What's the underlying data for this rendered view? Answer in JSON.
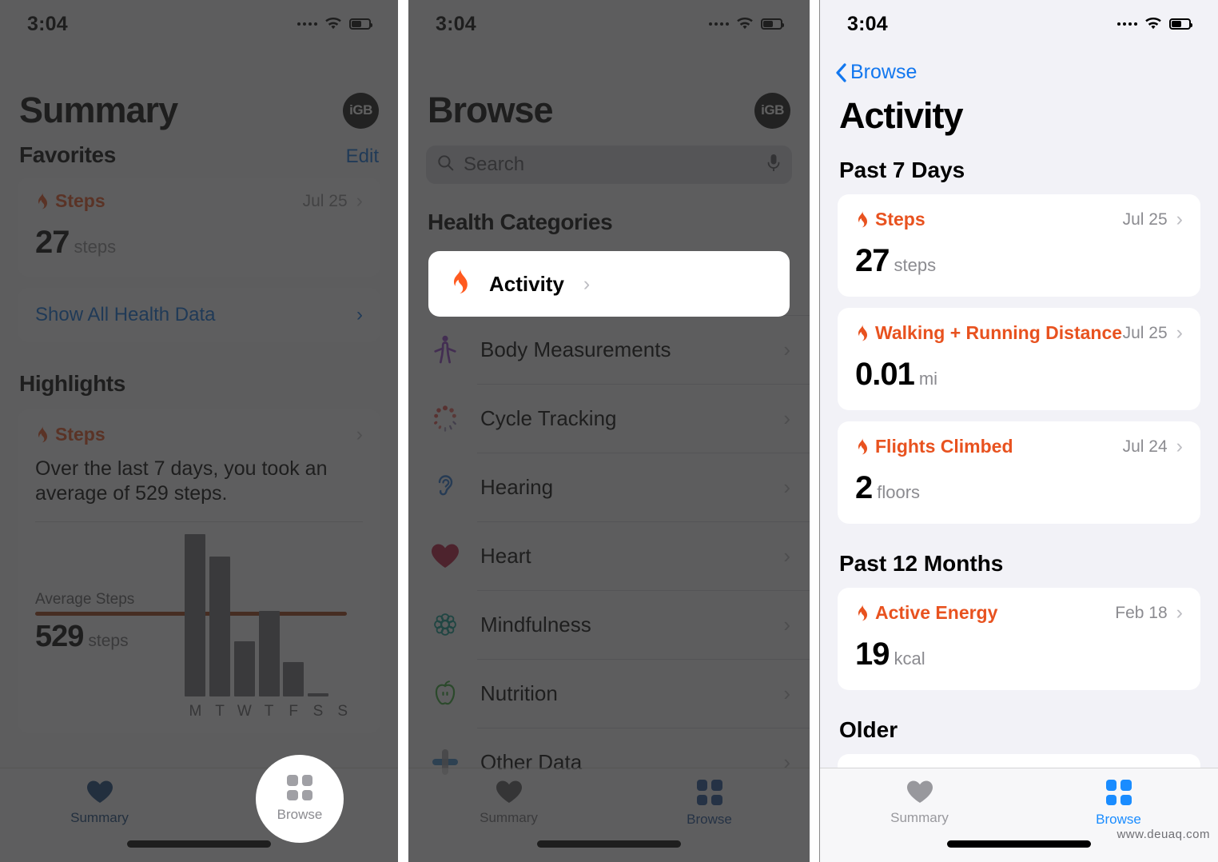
{
  "statusbar": {
    "time": "3:04"
  },
  "panel1": {
    "title": "Summary",
    "avatar": "iGB",
    "favorites_header": "Favorites",
    "edit_label": "Edit",
    "favorite_card": {
      "title": "Steps",
      "date": "Jul 25",
      "value": "27",
      "unit": "steps"
    },
    "show_all_label": "Show All Health Data",
    "highlights_header": "Highlights",
    "highlight_card": {
      "title": "Steps",
      "description": "Over the last 7 days, you took an average of 529 steps.",
      "avg_label": "Average Steps",
      "avg_value": "529",
      "avg_unit": "steps"
    },
    "tabbar": {
      "summary": "Summary",
      "browse": "Browse"
    }
  },
  "chart_data": {
    "type": "bar",
    "title": "Average Steps",
    "categories": [
      "M",
      "T",
      "W",
      "T",
      "F",
      "S",
      "S"
    ],
    "values": [
      1180,
      1020,
      400,
      620,
      250,
      20,
      0
    ],
    "xlabel": "",
    "ylabel": "steps",
    "ylim": [
      0,
      1250
    ],
    "grid": false,
    "legend": "none",
    "annotations": [
      {
        "type": "average-line",
        "label": "Average Steps",
        "value": 529,
        "color": "#9c3a10"
      }
    ]
  },
  "panel2": {
    "title": "Browse",
    "avatar": "iGB",
    "search": {
      "placeholder": "Search",
      "value": ""
    },
    "section_header": "Health Categories",
    "categories": [
      {
        "label": "Activity",
        "icon": "flame-icon",
        "color": "#ff5a1f",
        "highlighted": true
      },
      {
        "label": "Body Measurements",
        "icon": "body-icon",
        "color": "#8e3fc7"
      },
      {
        "label": "Cycle Tracking",
        "icon": "cycle-icon",
        "color": "#e0504a"
      },
      {
        "label": "Hearing",
        "icon": "ear-icon",
        "color": "#1f6fd0"
      },
      {
        "label": "Heart",
        "icon": "heart-icon",
        "color": "#b5143c"
      },
      {
        "label": "Mindfulness",
        "icon": "mindfulness-icon",
        "color": "#0e9b8e"
      },
      {
        "label": "Nutrition",
        "icon": "apple-icon",
        "color": "#35a635"
      },
      {
        "label": "Other Data",
        "icon": "cross-icon",
        "color": "#3d87c9"
      }
    ],
    "tabbar": {
      "summary": "Summary",
      "browse": "Browse"
    }
  },
  "panel3": {
    "back_label": "Browse",
    "title": "Activity",
    "sections": [
      {
        "header": "Past 7 Days",
        "cards": [
          {
            "title": "Steps",
            "date": "Jul 25",
            "value": "27",
            "unit": "steps"
          },
          {
            "title": "Walking + Running Distance",
            "date": "Jul 25",
            "value": "0.01",
            "unit": "mi"
          },
          {
            "title": "Flights Climbed",
            "date": "Jul 24",
            "value": "2",
            "unit": "floors"
          }
        ]
      },
      {
        "header": "Past 12 Months",
        "cards": [
          {
            "title": "Active Energy",
            "date": "Feb 18",
            "value": "19",
            "unit": "kcal"
          }
        ]
      },
      {
        "header": "Older",
        "cards": []
      }
    ],
    "tabbar": {
      "summary": "Summary",
      "browse": "Browse"
    }
  },
  "watermark": "www.deuaq.com",
  "colors": {
    "accent_orange": "#e8521f",
    "accent_blue": "#1277ef",
    "avg_line": "#9c3a10",
    "bar": "#6e6e73"
  }
}
